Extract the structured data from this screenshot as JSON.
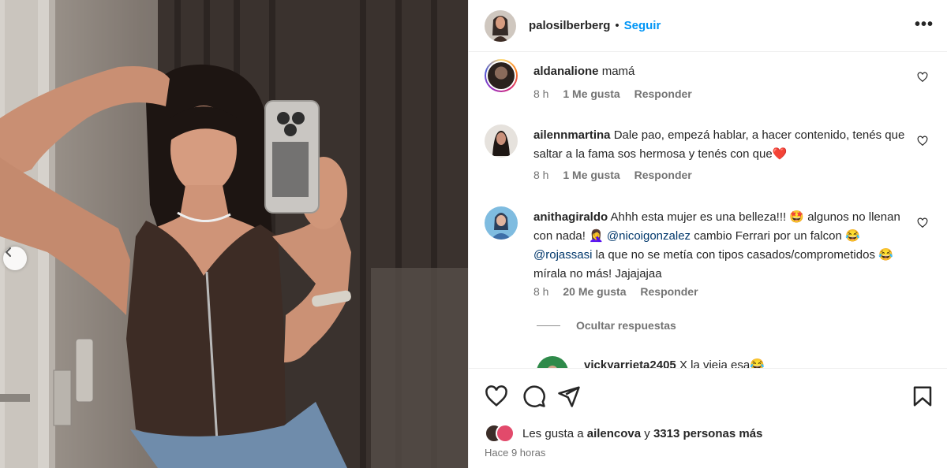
{
  "post": {
    "username": "palosilberberg",
    "separator": "•",
    "follow_label": "Seguir",
    "more_label": "•••"
  },
  "comments": [
    {
      "username": "aldanalione",
      "text": "mamá",
      "time": "8 h",
      "likes": "1 Me gusta",
      "reply": "Responder"
    },
    {
      "username": "ailennmartina",
      "text": "Dale pao, empezá hablar, a hacer contenido, tenés que saltar a la fama sos hermosa y tenés con que",
      "emoji": "❤️",
      "time": "8 h",
      "likes": "1 Me gusta",
      "reply": "Responder"
    },
    {
      "username": "anithagiraldo",
      "text_1": "Ahhh esta mujer es una belleza!!!",
      "emoji_1": "🤩",
      "text_2": "algunos no llenan con nada!",
      "emoji_2": "🤦‍♀️",
      "mention_1": "@nicoigonzalez",
      "text_3": "cambio Ferrari por un falcon",
      "emoji_3": "😂",
      "mention_2": "@rojassasi",
      "text_4": "la que no se metía con tipos casados/comprometidos",
      "emoji_4": "😂",
      "text_5": "mírala no más! Jajajajaa",
      "time": "8 h",
      "likes": "20 Me gusta",
      "reply": "Responder"
    }
  ],
  "hide_replies_label": "Ocultar respuestas",
  "reply": {
    "username": "vickyarrieta2405",
    "text": "X la vieja esa",
    "emoji": "😂"
  },
  "likes_line": {
    "prefix": "Les gusta a",
    "user": "ailencova",
    "connector": "y",
    "others": "3313 personas más"
  },
  "time_ago": "Hace 9 horas",
  "icons": {
    "like": "heart-icon",
    "comment": "comment-icon",
    "share": "send-icon",
    "save": "bookmark-icon",
    "prev": "chevron-left-icon"
  },
  "colors": {
    "follow": "#0095f6",
    "mention": "#00376b",
    "muted": "#737373"
  }
}
